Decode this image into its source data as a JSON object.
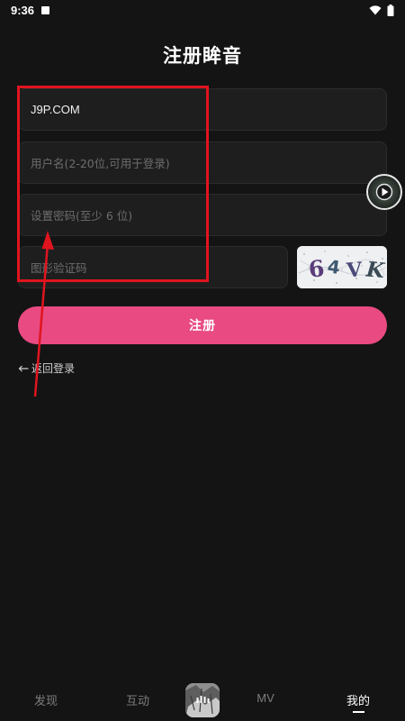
{
  "status_bar": {
    "time": "9:36",
    "icons": [
      "notification-square-icon",
      "wifi-icon",
      "battery-icon"
    ]
  },
  "page": {
    "title": "注册眸音"
  },
  "form": {
    "username_value": "J9P.COM",
    "name_placeholder": "用户名(2-20位,可用于登录)",
    "password_placeholder": "设置密码(至少 6 位)",
    "captcha_placeholder": "图形验证码",
    "captcha_text": "64VK",
    "register_label": "注册",
    "back_label": "返回登录"
  },
  "bottom_nav": {
    "items": [
      {
        "label": "发现",
        "active": false
      },
      {
        "label": "互动",
        "active": false
      },
      {
        "label": "MV",
        "active": false
      },
      {
        "label": "我的",
        "active": true
      }
    ]
  },
  "colors": {
    "background": "#141414",
    "accent": "#e94a82",
    "annotation": "#e0141e"
  }
}
